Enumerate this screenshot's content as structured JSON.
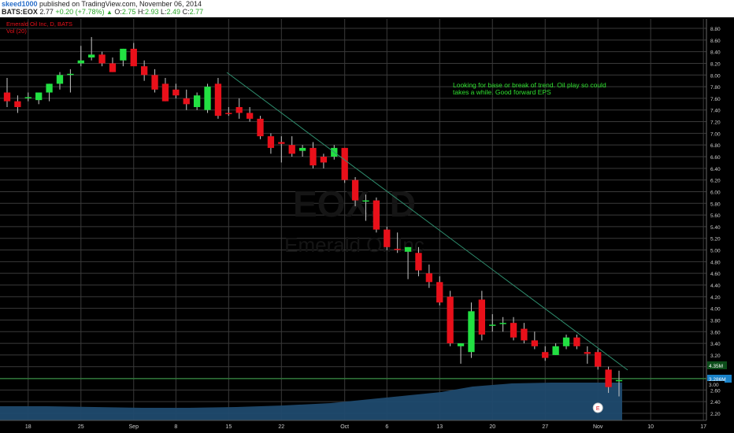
{
  "header": {
    "user": "skeed1000",
    "published": " published on TradingView.com, November 06, 2014",
    "symbol": "BATS:EOX",
    "last": "2.77",
    "change": "+0.20 (+7.78%)",
    "open_label": "O:",
    "open": "2.75",
    "high_label": "H:",
    "high": "2.93",
    "low_label": "L:",
    "low": "2.49",
    "close_label": "C:",
    "close": "2.77"
  },
  "chart_data": {
    "type": "candlestick",
    "title": "Emerald Oil Inc, D, BATS",
    "volume_label": "Vol (20)",
    "watermark_symbol": "EOX, D",
    "watermark_name": "Emerald Oil Inc",
    "annotation": [
      "Looking for base or break of trend. Oil play so could",
      "takes a while. Good forward EPS"
    ],
    "y_ticks": [
      "8.80",
      "8.60",
      "8.40",
      "8.20",
      "8.00",
      "7.80",
      "7.60",
      "7.40",
      "7.20",
      "7.00",
      "6.80",
      "6.60",
      "6.40",
      "6.20",
      "6.00",
      "5.80",
      "5.60",
      "5.40",
      "5.20",
      "5.00",
      "4.80",
      "4.60",
      "4.40",
      "4.20",
      "4.00",
      "3.80",
      "3.60",
      "3.40",
      "3.20",
      "3.00",
      "2.80",
      "2.60",
      "2.40",
      "2.20"
    ],
    "ylim": [
      2.1,
      8.9
    ],
    "x_ticks": [
      "18",
      "25",
      "Sep",
      "8",
      "15",
      "22",
      "Oct",
      "6",
      "13",
      "20",
      "27",
      "Nov",
      "10",
      "17"
    ],
    "price_label": "3.00",
    "volume_labels": [
      "4.35M",
      "3.286M"
    ],
    "earnings_marker": "E",
    "candles": [
      {
        "date": "Aug 14",
        "o": 7.7,
        "h": 7.95,
        "l": 7.45,
        "c": 7.55
      },
      {
        "date": "Aug 15",
        "o": 7.55,
        "h": 7.65,
        "l": 7.35,
        "c": 7.45
      },
      {
        "date": "Aug 18",
        "o": 7.6,
        "h": 7.7,
        "l": 7.55,
        "c": 7.62
      },
      {
        "date": "Aug 19",
        "o": 7.57,
        "h": 7.7,
        "l": 7.5,
        "c": 7.7
      },
      {
        "date": "Aug 20",
        "o": 7.7,
        "h": 7.85,
        "l": 7.55,
        "c": 7.85
      },
      {
        "date": "Aug 21",
        "o": 7.85,
        "h": 8.05,
        "l": 7.75,
        "c": 8.0
      },
      {
        "date": "Aug 22",
        "o": 8.0,
        "h": 8.1,
        "l": 7.7,
        "c": 8.02
      },
      {
        "date": "Aug 25",
        "o": 8.2,
        "h": 8.5,
        "l": 8.15,
        "c": 8.25
      },
      {
        "date": "Aug 26",
        "o": 8.3,
        "h": 8.65,
        "l": 8.25,
        "c": 8.35
      },
      {
        "date": "Aug 27",
        "o": 8.35,
        "h": 8.4,
        "l": 8.15,
        "c": 8.2
      },
      {
        "date": "Aug 28",
        "o": 8.2,
        "h": 8.3,
        "l": 8.05,
        "c": 8.05
      },
      {
        "date": "Aug 29",
        "o": 8.25,
        "h": 8.45,
        "l": 8.15,
        "c": 8.45
      },
      {
        "date": "Sep 2",
        "o": 8.45,
        "h": 8.55,
        "l": 8.2,
        "c": 8.15
      },
      {
        "date": "Sep 3",
        "o": 8.15,
        "h": 8.25,
        "l": 7.9,
        "c": 8.0
      },
      {
        "date": "Sep 4",
        "o": 8.0,
        "h": 8.1,
        "l": 7.7,
        "c": 7.75
      },
      {
        "date": "Sep 5",
        "o": 7.85,
        "h": 7.95,
        "l": 7.55,
        "c": 7.55
      },
      {
        "date": "Sep 8",
        "o": 7.75,
        "h": 7.85,
        "l": 7.6,
        "c": 7.65
      },
      {
        "date": "Sep 9",
        "o": 7.6,
        "h": 7.75,
        "l": 7.4,
        "c": 7.5
      },
      {
        "date": "Sep 10",
        "o": 7.45,
        "h": 7.7,
        "l": 7.4,
        "c": 7.65
      },
      {
        "date": "Sep 11",
        "o": 7.4,
        "h": 7.85,
        "l": 7.35,
        "c": 7.8
      },
      {
        "date": "Sep 12",
        "o": 7.85,
        "h": 7.95,
        "l": 7.25,
        "c": 7.3
      },
      {
        "date": "Sep 15",
        "o": 7.35,
        "h": 7.45,
        "l": 7.3,
        "c": 7.34
      },
      {
        "date": "Sep 16",
        "o": 7.45,
        "h": 7.6,
        "l": 7.25,
        "c": 7.35
      },
      {
        "date": "Sep 17",
        "o": 7.35,
        "h": 7.45,
        "l": 7.2,
        "c": 7.25
      },
      {
        "date": "Sep 18",
        "o": 7.25,
        "h": 7.3,
        "l": 6.9,
        "c": 6.95
      },
      {
        "date": "Sep 19",
        "o": 6.95,
        "h": 7.0,
        "l": 6.65,
        "c": 6.75
      },
      {
        "date": "Sep 22",
        "o": 6.85,
        "h": 6.95,
        "l": 6.5,
        "c": 6.82
      },
      {
        "date": "Sep 23",
        "o": 6.8,
        "h": 6.95,
        "l": 6.6,
        "c": 6.65
      },
      {
        "date": "Sep 24",
        "o": 6.7,
        "h": 6.8,
        "l": 6.6,
        "c": 6.75
      },
      {
        "date": "Sep 25",
        "o": 6.75,
        "h": 6.85,
        "l": 6.4,
        "c": 6.45
      },
      {
        "date": "Sep 26",
        "o": 6.6,
        "h": 6.65,
        "l": 6.4,
        "c": 6.5
      },
      {
        "date": "Sep 29",
        "o": 6.6,
        "h": 6.8,
        "l": 6.55,
        "c": 6.75
      },
      {
        "date": "Sep 30",
        "o": 6.75,
        "h": 6.75,
        "l": 6.15,
        "c": 6.2
      },
      {
        "date": "Oct 1",
        "o": 6.2,
        "h": 6.25,
        "l": 5.75,
        "c": 5.85
      },
      {
        "date": "Oct 2",
        "o": 5.85,
        "h": 5.95,
        "l": 5.5,
        "c": 5.85
      },
      {
        "date": "Oct 3",
        "o": 5.85,
        "h": 5.9,
        "l": 5.3,
        "c": 5.35
      },
      {
        "date": "Oct 6",
        "o": 5.35,
        "h": 5.4,
        "l": 5.0,
        "c": 5.05
      },
      {
        "date": "Oct 7",
        "o": 5.02,
        "h": 5.3,
        "l": 4.95,
        "c": 5.0
      },
      {
        "date": "Oct 8",
        "o": 4.97,
        "h": 5.05,
        "l": 4.5,
        "c": 5.05
      },
      {
        "date": "Oct 9",
        "o": 4.95,
        "h": 5.05,
        "l": 4.55,
        "c": 4.65
      },
      {
        "date": "Oct 10",
        "o": 4.6,
        "h": 4.75,
        "l": 4.35,
        "c": 4.45
      },
      {
        "date": "Oct 13",
        "o": 4.45,
        "h": 4.55,
        "l": 4.05,
        "c": 4.1
      },
      {
        "date": "Oct 14",
        "o": 4.2,
        "h": 4.3,
        "l": 3.35,
        "c": 3.4
      },
      {
        "date": "Oct 15",
        "o": 3.35,
        "h": 3.4,
        "l": 3.05,
        "c": 3.4
      },
      {
        "date": "Oct 16",
        "o": 3.25,
        "h": 4.1,
        "l": 3.15,
        "c": 3.95
      },
      {
        "date": "Oct 17",
        "o": 4.15,
        "h": 4.3,
        "l": 3.45,
        "c": 3.55
      },
      {
        "date": "Oct 20",
        "o": 3.7,
        "h": 3.9,
        "l": 3.6,
        "c": 3.72
      },
      {
        "date": "Oct 21",
        "o": 3.75,
        "h": 3.85,
        "l": 3.6,
        "c": 3.75
      },
      {
        "date": "Oct 22",
        "o": 3.75,
        "h": 3.85,
        "l": 3.45,
        "c": 3.5
      },
      {
        "date": "Oct 23",
        "o": 3.65,
        "h": 3.75,
        "l": 3.4,
        "c": 3.45
      },
      {
        "date": "Oct 24",
        "o": 3.45,
        "h": 3.6,
        "l": 3.3,
        "c": 3.35
      },
      {
        "date": "Oct 27",
        "o": 3.25,
        "h": 3.35,
        "l": 3.1,
        "c": 3.15
      },
      {
        "date": "Oct 28",
        "o": 3.2,
        "h": 3.4,
        "l": 3.2,
        "c": 3.35
      },
      {
        "date": "Oct 29",
        "o": 3.35,
        "h": 3.55,
        "l": 3.3,
        "c": 3.5
      },
      {
        "date": "Oct 30",
        "o": 3.5,
        "h": 3.55,
        "l": 3.3,
        "c": 3.35
      },
      {
        "date": "Oct 31",
        "o": 3.25,
        "h": 3.35,
        "l": 3.05,
        "c": 3.22
      },
      {
        "date": "Nov 3",
        "o": 3.25,
        "h": 3.3,
        "l": 2.95,
        "c": 3.0
      },
      {
        "date": "Nov 4",
        "o": 2.95,
        "h": 3.0,
        "l": 2.55,
        "c": 2.65
      },
      {
        "date": "Nov 5",
        "o": 2.75,
        "h": 2.93,
        "l": 2.49,
        "c": 2.77
      }
    ],
    "colors": {
      "up": "#22e042",
      "down": "#e8101a",
      "wick": "#c8c8c8",
      "grid": "#3a3a3a",
      "trendline": "#2f8f6f",
      "annotation": "#2fe02f",
      "title": "#e8101a",
      "volume_area": "#1f4a6e",
      "volume_box": "#1a82c8"
    }
  }
}
